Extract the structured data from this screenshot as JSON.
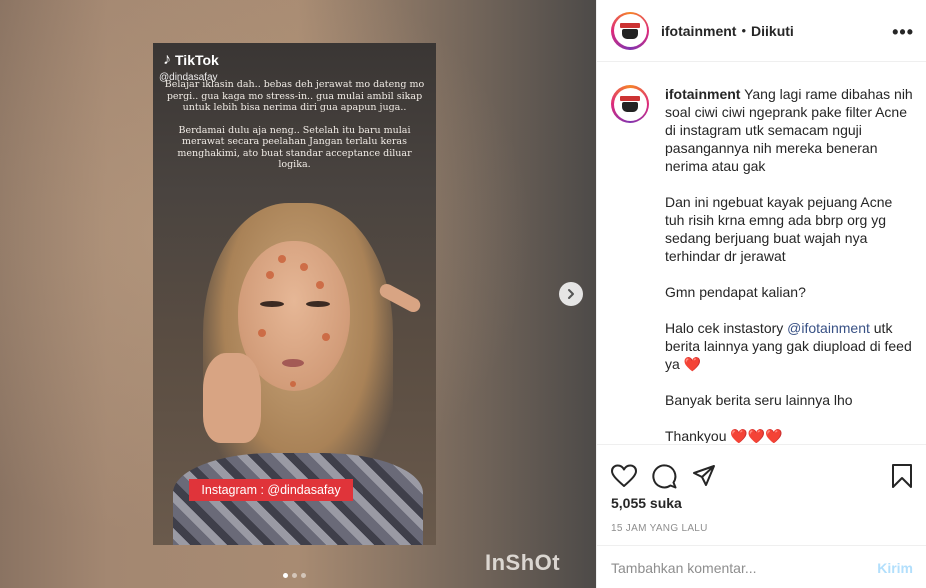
{
  "media": {
    "tiktok_brand": "TikTok",
    "tiktok_handle": "@dindasafay",
    "caption_lines": [
      "Belajar iklasin dah.. bebas deh jerawat mo dateng mo pergi.. gua kaga mo stress-in.. gua mulai ambil sikap untuk lebih bisa nerima diri gua apapun juga..",
      "Berdamai dulu aja neng.. Setelah itu baru mulai merawat secara peelahan Jangan terlalu keras menghakimi, ato buat standar acceptance diluar logika."
    ],
    "instagram_tag": "Instagram : @dindasafay",
    "watermark": "InShOt",
    "carousel_dots": 3,
    "active_dot": 0
  },
  "header": {
    "username": "ifotainment",
    "separator": "•",
    "follow_status": "Diikuti",
    "more_label": "•••"
  },
  "caption": {
    "username": "ifotainment",
    "para1": "Yang lagi rame dibahas nih soal ciwi ciwi ngeprank pake filter Acne di instagram utk semacam nguji pasangannya nih mereka beneran nerima atau gak",
    "para2": "Dan ini ngebuat kayak pejuang Acne tuh risih krna emng ada bbrp org yg sedang berjuang buat wajah nya terhindar dr jerawat",
    "para3": "Gmn pendapat kalian?",
    "para4_pre": "Halo cek instastory ",
    "para4_mention": "@ifotainment",
    "para4_post": " utk berita lainnya yang gak diupload di feed ya",
    "heart": "❤️",
    "para5": "Banyak berita seru lainnya lho",
    "para6": "Thankyou",
    "hearts": "❤️❤️❤️"
  },
  "stats": {
    "likes": "5,055 suka",
    "timestamp": "15 JAM YANG LALU"
  },
  "comment": {
    "placeholder": "Tambahkan komentar...",
    "post_label": "Kirim"
  },
  "colors": {
    "accent_link": "#385185",
    "post_disabled": "#b2dffc",
    "ig_tag_bg": "#e0343a"
  }
}
